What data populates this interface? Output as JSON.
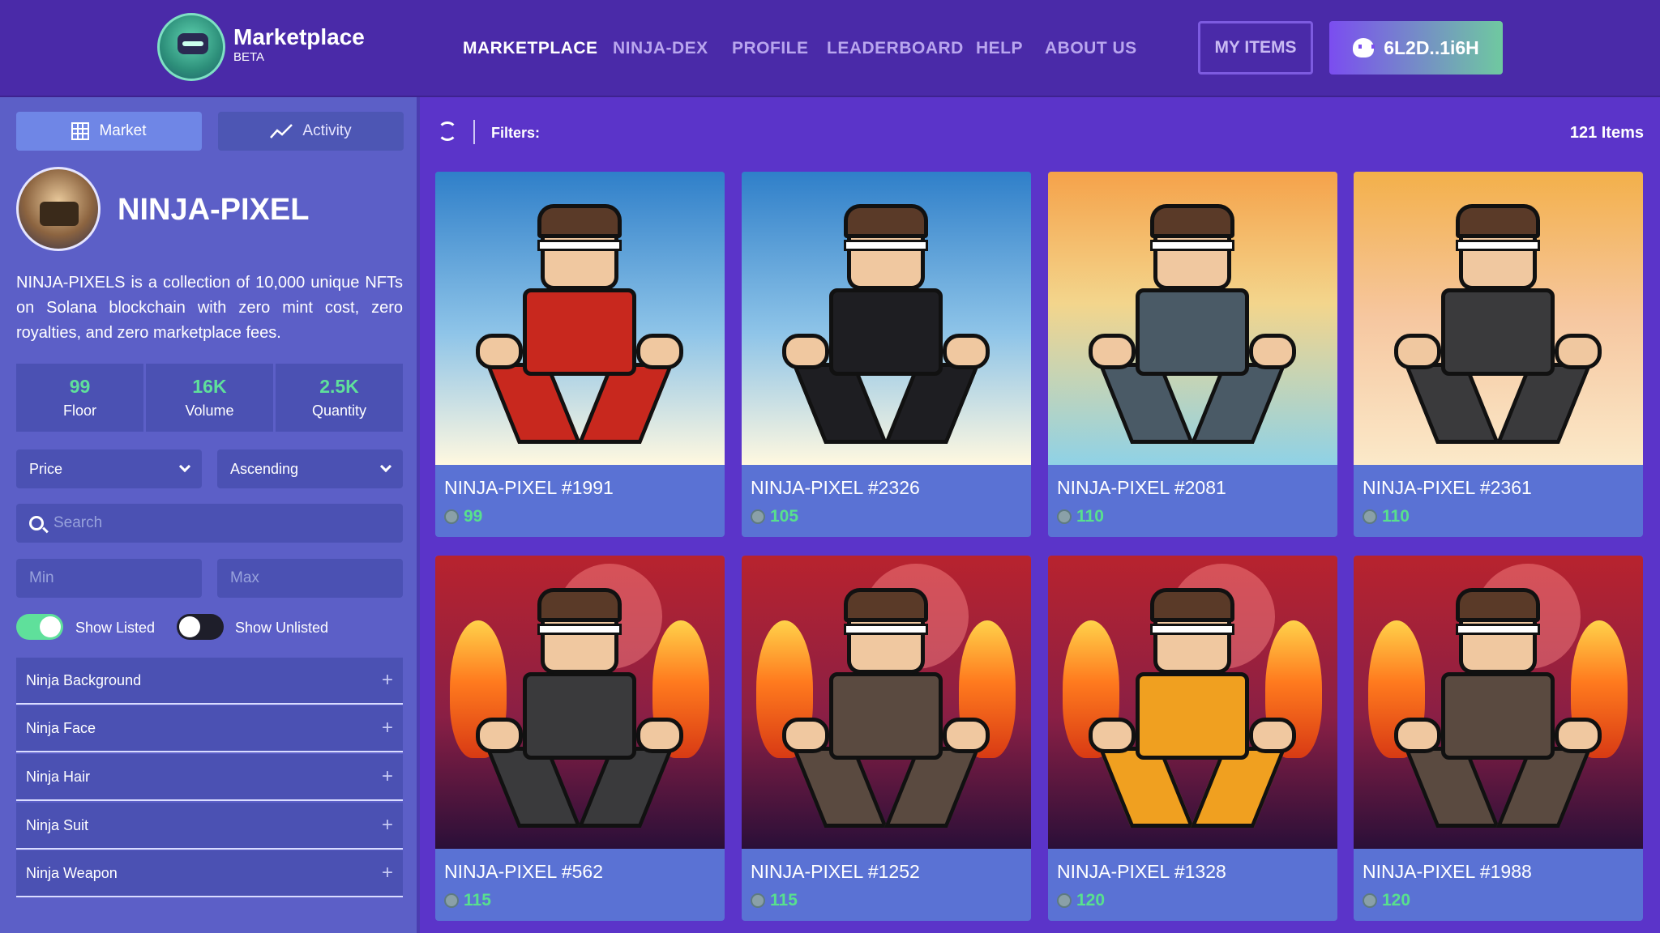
{
  "header": {
    "brand": "Marketplace",
    "badge": "BETA",
    "nav": [
      "MARKETPLACE",
      "NINJA-DEX",
      "PROFILE",
      "LEADERBOARD",
      "HELP",
      "ABOUT US"
    ],
    "active_nav": "MARKETPLACE",
    "my_items_label": "MY ITEMS",
    "wallet_label": "6L2D..1i6H",
    "wallet_icon": "phantom-ghost-icon"
  },
  "sidebar": {
    "tabs": {
      "market": "Market",
      "activity": "Activity"
    },
    "collection": {
      "name": "NINJA-PIXEL",
      "description": "NINJA-PIXELS is a collection of 10,000 unique NFTs on Solana blockchain with zero mint cost, zero royalties, and zero marketplace fees."
    },
    "stats": [
      {
        "value": "99",
        "label": "Floor"
      },
      {
        "value": "16K",
        "label": "Volume"
      },
      {
        "value": "2.5K",
        "label": "Quantity"
      }
    ],
    "sort_field": "Price",
    "sort_order": "Ascending",
    "search_placeholder": "Search",
    "min_placeholder": "Min",
    "max_placeholder": "Max",
    "show_listed": {
      "label": "Show Listed",
      "on": true
    },
    "show_unlisted": {
      "label": "Show Unlisted",
      "on": false
    },
    "traits": [
      "Ninja Background",
      "Ninja Face",
      "Ninja Hair",
      "Ninja Suit",
      "Ninja Weapon"
    ],
    "trait_expand_symbol": "+"
  },
  "toolbar": {
    "filters_label": "Filters:",
    "item_count": "121 Items"
  },
  "items": [
    {
      "name": "NINJA-PIXEL #1991",
      "price": "99",
      "bg": "sky",
      "suit": "#c8281e"
    },
    {
      "name": "NINJA-PIXEL #2326",
      "price": "105",
      "bg": "sky",
      "suit": "#1e1e22"
    },
    {
      "name": "NINJA-PIXEL #2081",
      "price": "110",
      "bg": "sunset",
      "suit": "#4a5a66"
    },
    {
      "name": "NINJA-PIXEL #2361",
      "price": "110",
      "bg": "peach",
      "suit": "#3a3a3c"
    },
    {
      "name": "NINJA-PIXEL #562",
      "price": "115",
      "bg": "crimson",
      "suit": "#3a3a3c"
    },
    {
      "name": "NINJA-PIXEL #1252",
      "price": "115",
      "bg": "crimson",
      "suit": "#5a4a40"
    },
    {
      "name": "NINJA-PIXEL #1328",
      "price": "120",
      "bg": "crimson",
      "suit": "#f0a020"
    },
    {
      "name": "NINJA-PIXEL #1988",
      "price": "120",
      "bg": "crimson",
      "suit": "#5a4a40"
    }
  ],
  "colors": {
    "accent": "#5c5fc7",
    "price_green": "#58e08e",
    "header_bg": "#4a2aa8",
    "toggle_on": "#5fe09b"
  }
}
